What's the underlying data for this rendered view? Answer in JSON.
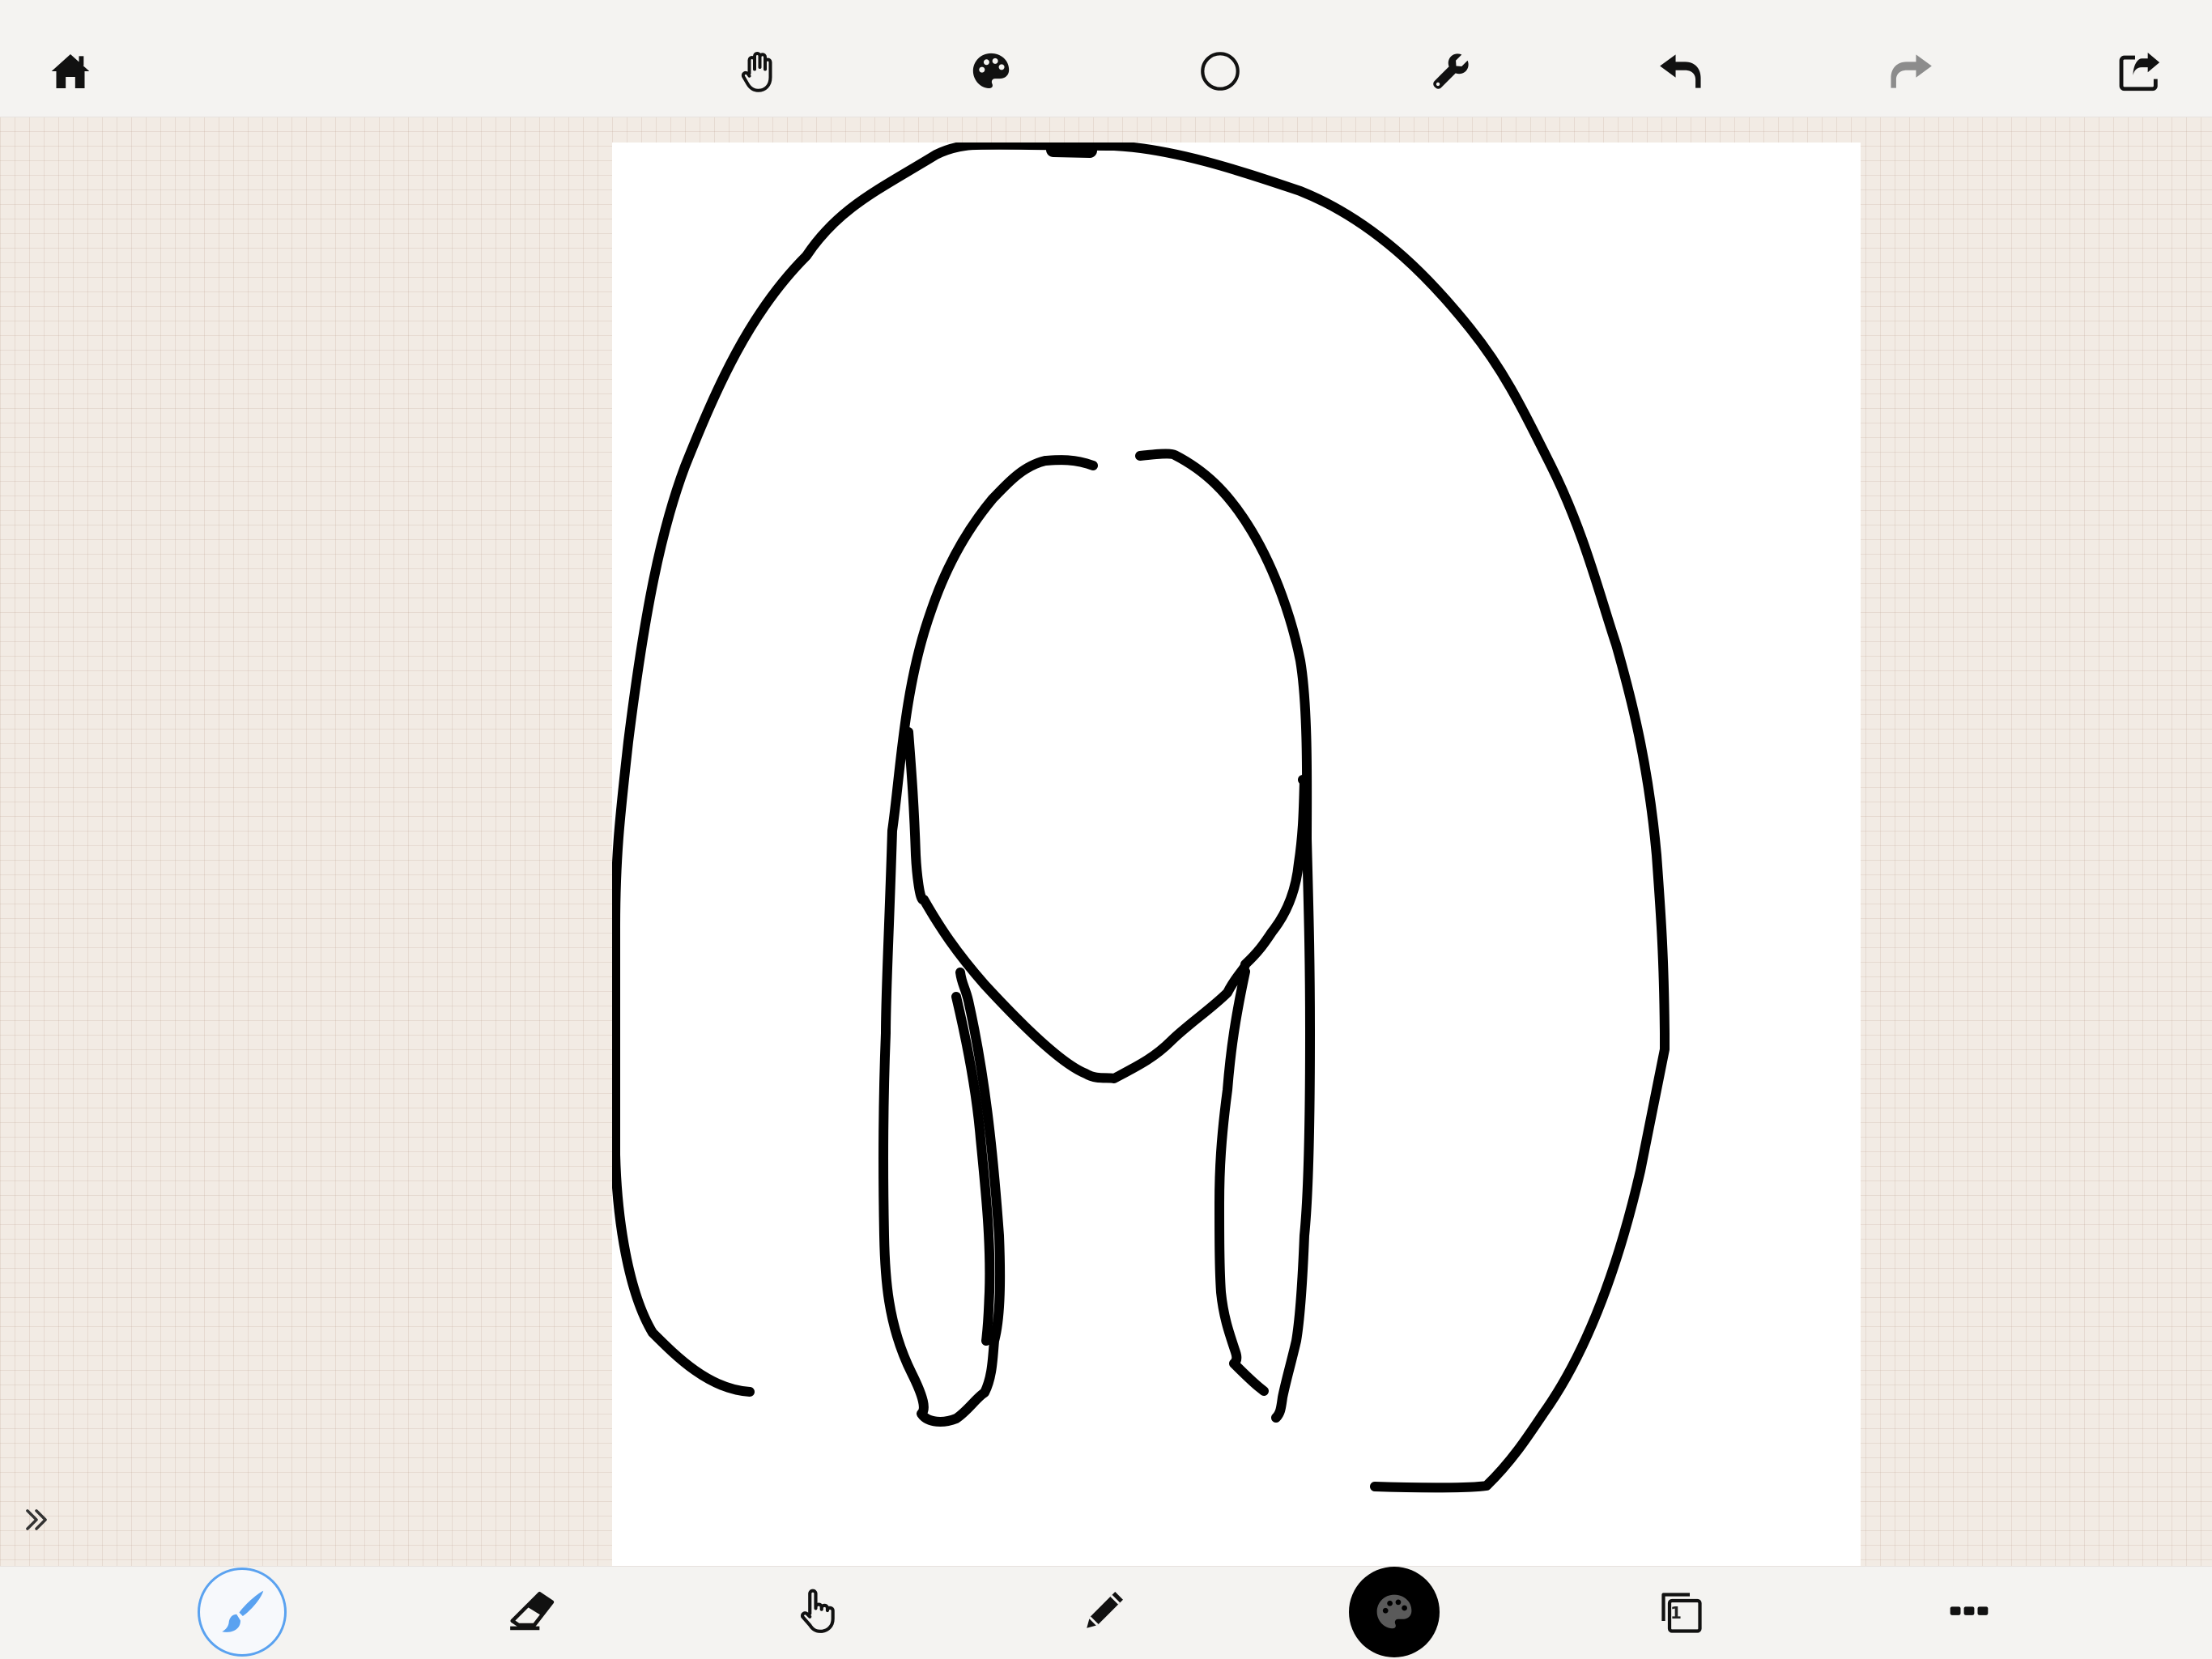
{
  "toolbar": {
    "icons": [
      "home-icon",
      "hand-icon",
      "palette-icon",
      "circle-icon",
      "wrench-icon",
      "undo-icon",
      "redo-icon",
      "share-icon"
    ],
    "redo_enabled": false
  },
  "bottom_toolbar": {
    "icons": [
      "brush-icon",
      "eraser-icon",
      "finger-icon",
      "pencil-icon",
      "palette-icon",
      "layers-icon",
      "more-icon"
    ],
    "active_tool": "brush",
    "layer_count": "1"
  },
  "colors": {
    "accent": "#5aa2f0",
    "current_color": "#000000",
    "stroke": "#000000",
    "toolbar_bg": "#f4f3f1",
    "workspace_bg": "#f2ebe4",
    "canvas_bg": "#ffffff"
  }
}
